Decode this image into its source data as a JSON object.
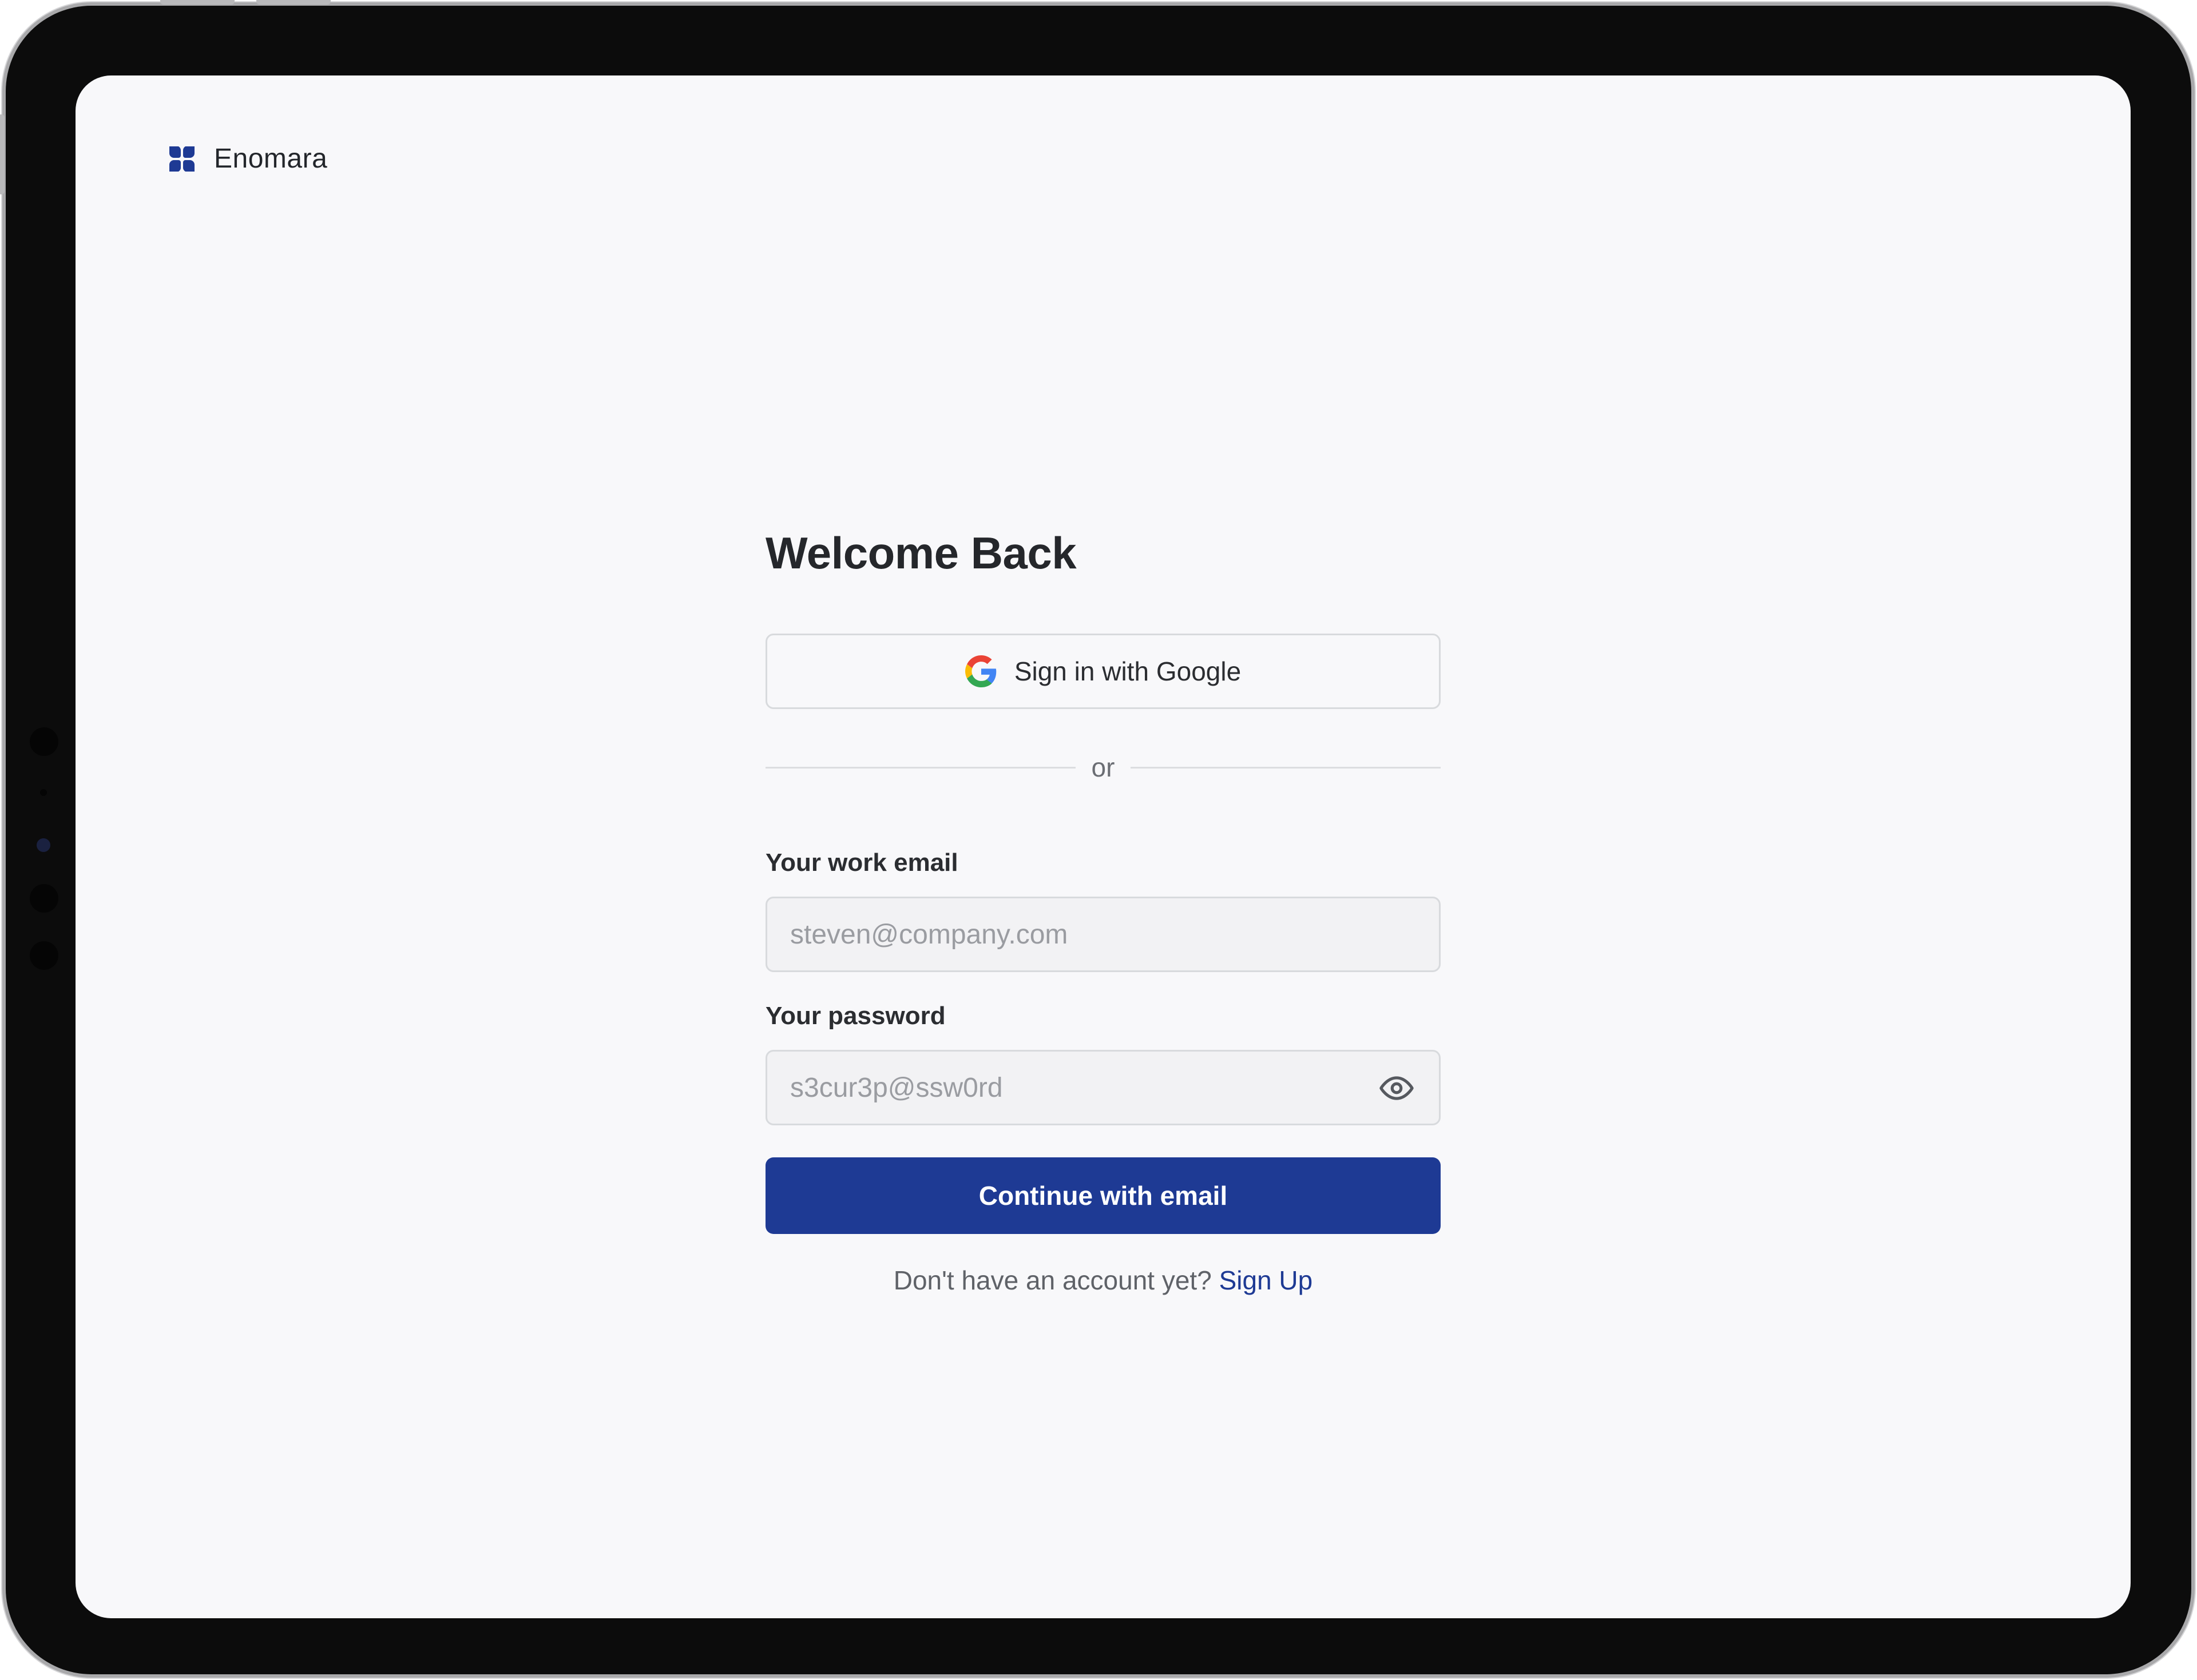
{
  "brand": {
    "name": "Enomara",
    "logo_icon": "four-petal-logo-icon",
    "color": "#1e3a94"
  },
  "login": {
    "title": "Welcome Back",
    "google_button": {
      "label": "Sign in with Google",
      "icon": "google-icon"
    },
    "divider_text": "or",
    "email": {
      "label": "Your work email",
      "placeholder": "steven@company.com",
      "value": ""
    },
    "password": {
      "label": "Your password",
      "placeholder": "s3cur3p@ssw0rd",
      "value": "",
      "toggle_icon": "eye-icon"
    },
    "submit_label": "Continue with email",
    "signup_prompt": "Don't have an account yet?",
    "signup_link": "Sign Up"
  },
  "colors": {
    "primary": "#1e3a94",
    "background": "#f8f8fa",
    "border": "#d8dadd"
  }
}
